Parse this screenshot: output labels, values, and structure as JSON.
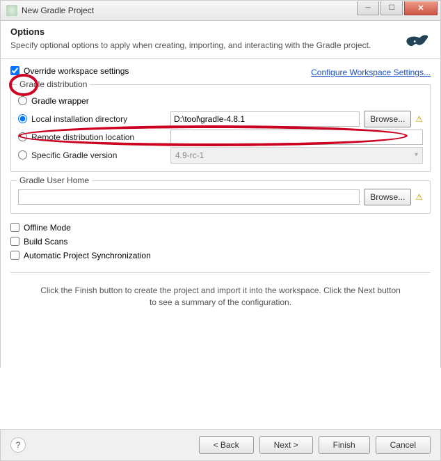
{
  "window": {
    "title": "New Gradle Project"
  },
  "header": {
    "title": "Options",
    "desc": "Specify optional options to apply when creating, importing, and interacting with the Gradle project."
  },
  "override": {
    "label": "Override workspace settings",
    "link": "Configure Workspace Settings..."
  },
  "dist": {
    "legend": "Gradle distribution",
    "wrapper": "Gradle wrapper",
    "local": "Local installation directory",
    "local_value": "D:\\tool\\gradle-4.8.1",
    "remote": "Remote distribution location",
    "specific": "Specific Gradle version",
    "specific_value": "4.9-rc-1",
    "browse": "Browse..."
  },
  "userhome": {
    "legend": "Gradle User Home",
    "browse": "Browse..."
  },
  "options": {
    "offline": "Offline Mode",
    "build_scans": "Build Scans",
    "autosync": "Automatic Project Synchronization"
  },
  "info": "Click the Finish button to create the project and import it into the workspace. Click the Next button to see a summary of the configuration.",
  "footer": {
    "back": "< Back",
    "next": "Next >",
    "finish": "Finish",
    "cancel": "Cancel"
  }
}
